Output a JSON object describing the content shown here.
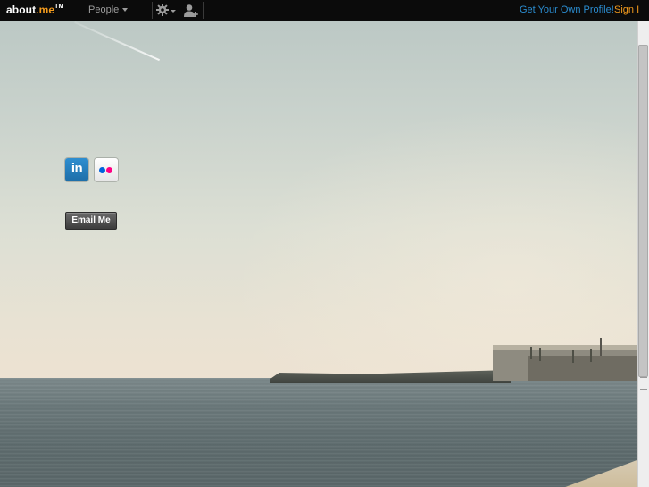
{
  "brand": {
    "logo_text": "about",
    "logo_dot_text": ".me",
    "logo_tm": "TM",
    "accent_color": "#f29a1d",
    "link_color": "#2b8dd1"
  },
  "topbar": {
    "people_label": "People",
    "settings_icon": "gear-icon",
    "add_user_icon": "add-user-icon",
    "get_profile_label": "Get Your Own Profile!",
    "signin_label": "Sign I"
  },
  "profile": {
    "social_links": [
      {
        "name": "linkedin",
        "icon": "linkedin-icon",
        "label": "in"
      },
      {
        "name": "flickr",
        "icon": "flickr-icon"
      }
    ],
    "email_button_label": "Email Me"
  }
}
